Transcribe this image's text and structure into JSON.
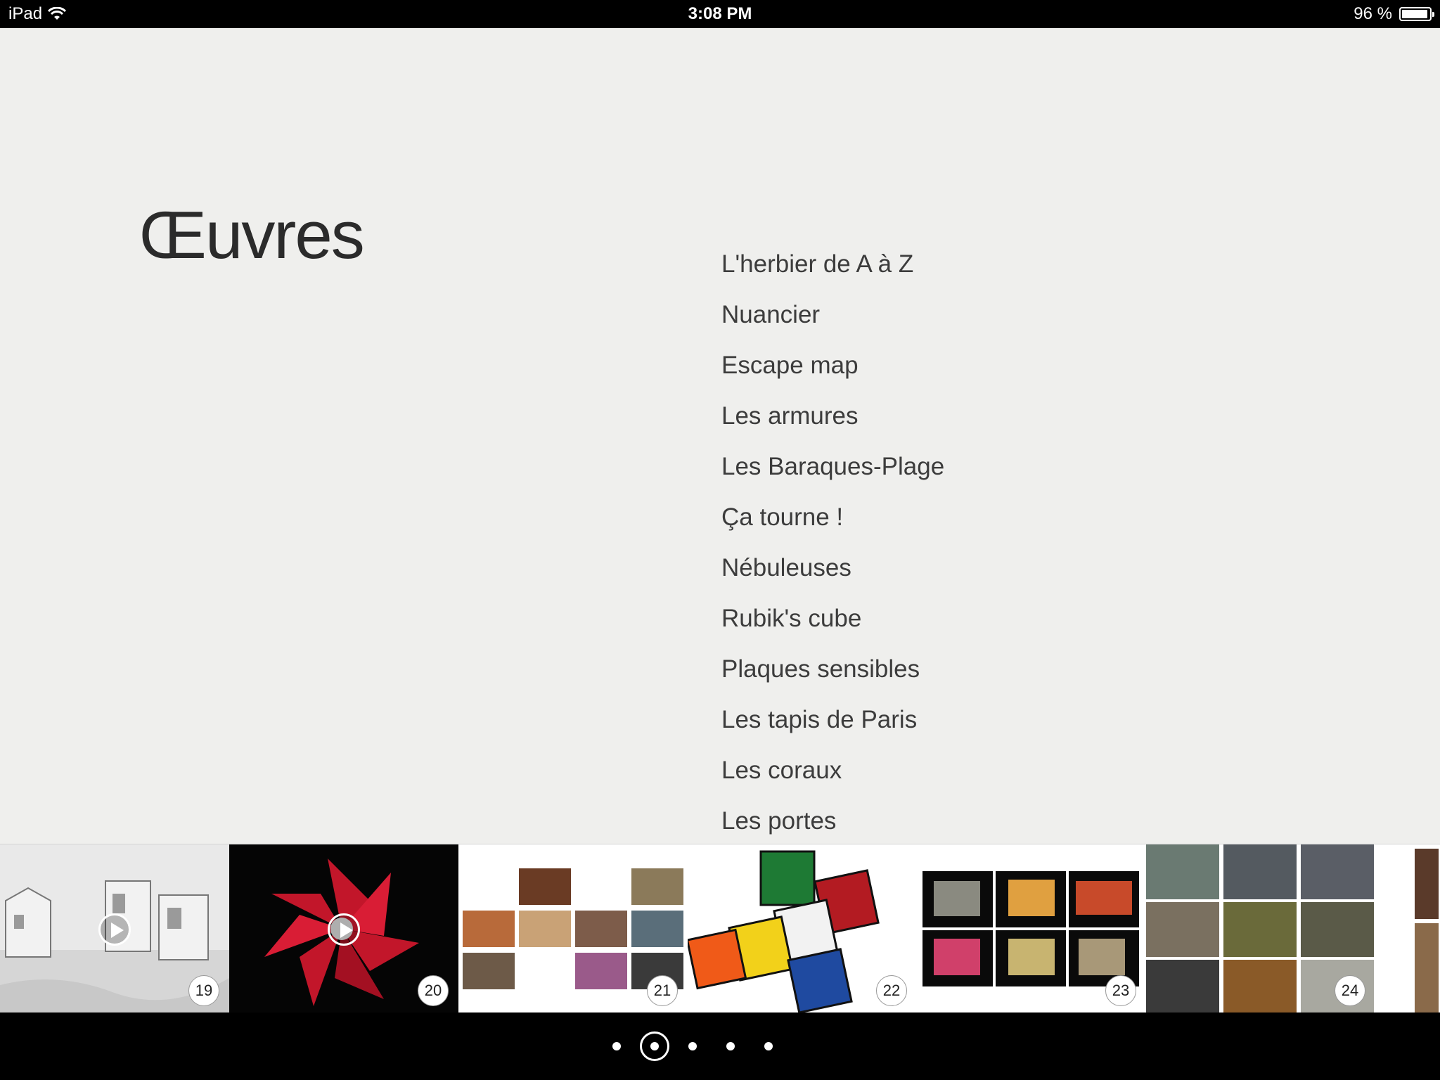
{
  "statusbar": {
    "device": "iPad",
    "time": "3:08 PM",
    "battery_text": "96 %",
    "battery_level": 0.96
  },
  "page": {
    "title": "Œuvres"
  },
  "works": [
    "L'herbier de A à Z",
    "Nuancier",
    "Escape map",
    "Les armures",
    "Les Baraques-Plage",
    "Ça tourne !",
    "Nébuleuses",
    "Rubik's cube",
    "Plaques sensibles",
    "Les tapis de Paris",
    "Les coraux",
    "Les portes"
  ],
  "thumbnails": [
    {
      "number": "19",
      "video": true
    },
    {
      "number": "20",
      "video": true
    },
    {
      "number": "21",
      "video": false
    },
    {
      "number": "22",
      "video": false
    },
    {
      "number": "23",
      "video": false
    },
    {
      "number": "24",
      "video": false
    }
  ],
  "pager": {
    "count": 5,
    "active": 1
  },
  "icons": {
    "wifi": "wifi-icon",
    "battery": "battery-icon",
    "play": "play-icon"
  }
}
